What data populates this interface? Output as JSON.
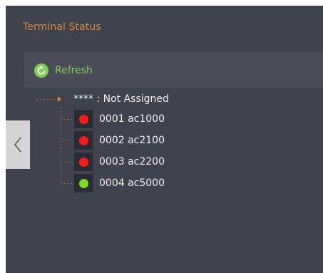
{
  "panel": {
    "title": "Terminal Status"
  },
  "toolbar": {
    "refresh_label": "Refresh",
    "refresh_icon": "refresh-icon"
  },
  "tree": {
    "root_label": "**** : Not Assigned",
    "nodes": [
      {
        "label": "0001 ac1000",
        "status": "offline"
      },
      {
        "label": "0002 ac2100",
        "status": "offline"
      },
      {
        "label": "0003 ac2200",
        "status": "offline"
      },
      {
        "label": "0004 ac5000",
        "status": "online"
      }
    ]
  },
  "colors": {
    "background": "#40424d",
    "title": "#d68a3c",
    "refresh_text": "#7fcf55",
    "status_offline": "#ff1a1a",
    "status_online": "#7ddc1f"
  },
  "side_toggle": {
    "icon": "chevron-left-icon"
  }
}
